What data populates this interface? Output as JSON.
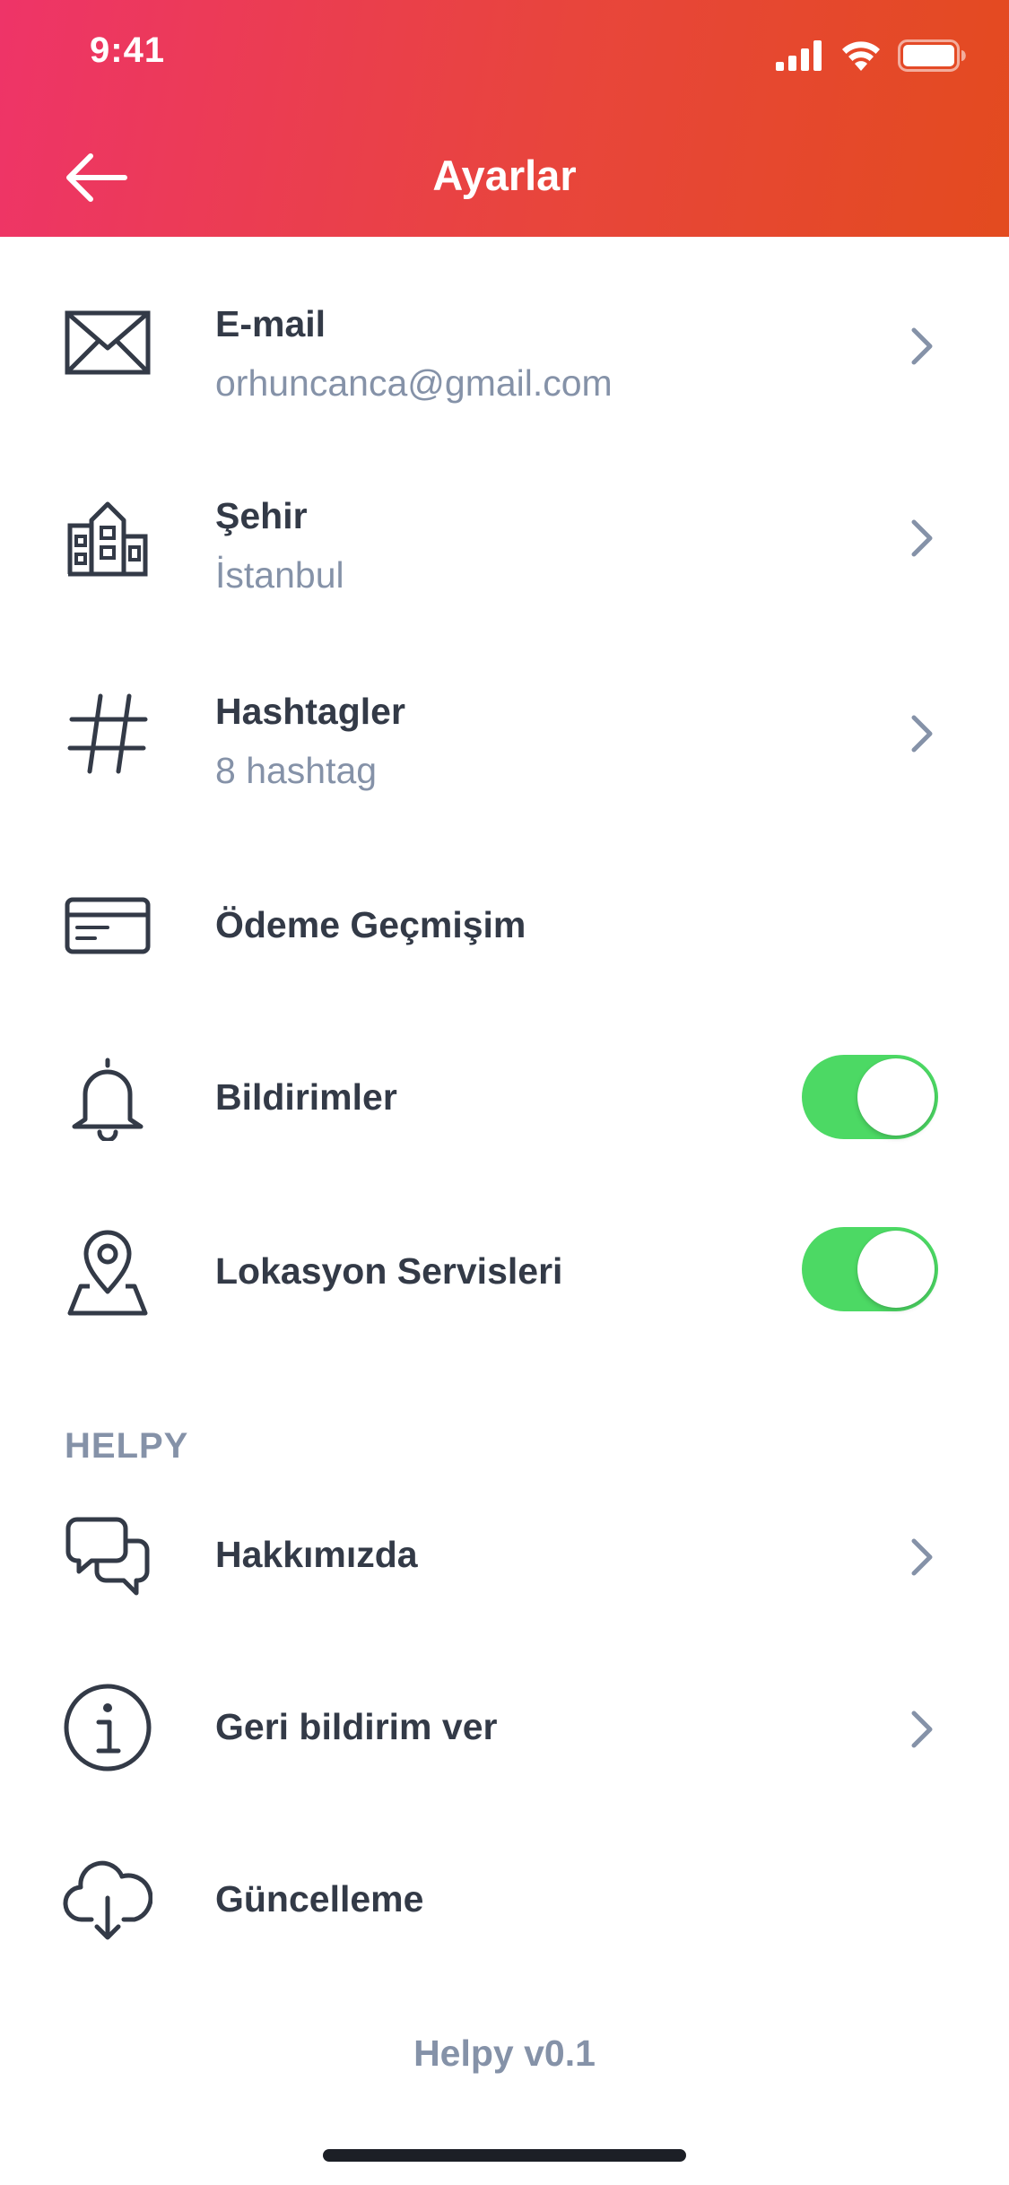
{
  "status_bar": {
    "time": "9:41",
    "icons": [
      "cellular-signal-icon",
      "wifi-icon",
      "battery-icon"
    ]
  },
  "header": {
    "title": "Ayarlar",
    "back_icon": "arrow-left-icon",
    "gradient_colors": [
      "#ee3468",
      "#e34b1f"
    ]
  },
  "settings": {
    "email": {
      "label": "E-mail",
      "value": "orhuncanca@gmail.com",
      "icon": "envelope-icon"
    },
    "city": {
      "label": "Şehir",
      "value": "İstanbul",
      "icon": "buildings-icon"
    },
    "hashtags": {
      "label": "Hashtagler",
      "value": "8 hashtag",
      "icon": "hashtag-icon"
    },
    "payments": {
      "label": "Ödeme Geçmişim",
      "icon": "credit-card-icon"
    },
    "notifications": {
      "label": "Bildirimler",
      "icon": "bell-icon",
      "enabled": true
    },
    "location": {
      "label": "Lokasyon Servisleri",
      "icon": "map-pin-icon",
      "enabled": true
    }
  },
  "helpy_section": {
    "title": "HELPY",
    "about": {
      "label": "Hakkımızda",
      "icon": "chat-bubbles-icon"
    },
    "feedback": {
      "label": "Geri bildirim ver",
      "icon": "info-icon"
    },
    "update": {
      "label": "Güncelleme",
      "icon": "cloud-download-icon"
    }
  },
  "footer": {
    "version": "Helpy v0.1"
  },
  "colors": {
    "text_primary": "#333a47",
    "text_secondary": "#8592a8",
    "toggle_on": "#4cd964"
  }
}
